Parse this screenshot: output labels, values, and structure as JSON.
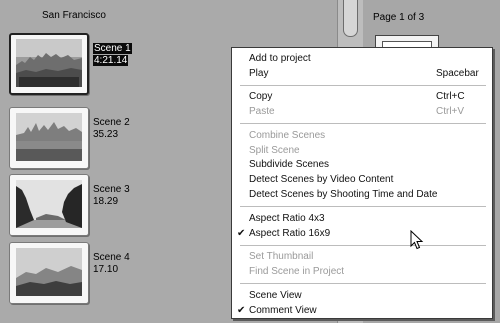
{
  "album": {
    "title": "San Francisco"
  },
  "scenes": [
    {
      "name": "Scene 1",
      "duration": "4:21.14",
      "selected": true
    },
    {
      "name": "Scene 2",
      "duration": "35.23",
      "selected": false
    },
    {
      "name": "Scene 3",
      "duration": "18.29",
      "selected": false
    },
    {
      "name": "Scene 4",
      "duration": "17.10",
      "selected": false
    }
  ],
  "right_panel": {
    "page_indicator": "Page 1 of 3"
  },
  "context_menu": {
    "items": [
      {
        "label": "Add to project",
        "shortcut": "",
        "enabled": true,
        "checked": false
      },
      {
        "label": "Play",
        "shortcut": "Spacebar",
        "enabled": true,
        "checked": false
      },
      {
        "label": "Copy",
        "shortcut": "Ctrl+C",
        "enabled": true,
        "checked": false
      },
      {
        "label": "Paste",
        "shortcut": "Ctrl+V",
        "enabled": false,
        "checked": false
      },
      {
        "label": "Combine Scenes",
        "shortcut": "",
        "enabled": false,
        "checked": false
      },
      {
        "label": "Split Scene",
        "shortcut": "",
        "enabled": false,
        "checked": false
      },
      {
        "label": "Subdivide Scenes",
        "shortcut": "",
        "enabled": true,
        "checked": false
      },
      {
        "label": "Detect Scenes by Video Content",
        "shortcut": "",
        "enabled": true,
        "checked": false
      },
      {
        "label": "Detect Scenes by Shooting Time and Date",
        "shortcut": "",
        "enabled": true,
        "checked": false
      },
      {
        "label": "Aspect Ratio 4x3",
        "shortcut": "",
        "enabled": true,
        "checked": false
      },
      {
        "label": "Aspect Ratio 16x9",
        "shortcut": "",
        "enabled": true,
        "checked": true
      },
      {
        "label": "Set Thumbnail",
        "shortcut": "",
        "enabled": false,
        "checked": false
      },
      {
        "label": "Find Scene in Project",
        "shortcut": "",
        "enabled": false,
        "checked": false
      },
      {
        "label": "Scene View",
        "shortcut": "",
        "enabled": true,
        "checked": false
      },
      {
        "label": "Comment View",
        "shortcut": "",
        "enabled": true,
        "checked": true
      }
    ],
    "check_glyph": "✔"
  },
  "icons": {
    "check": "checkmark-icon",
    "cursor": "mouse-pointer-icon"
  }
}
